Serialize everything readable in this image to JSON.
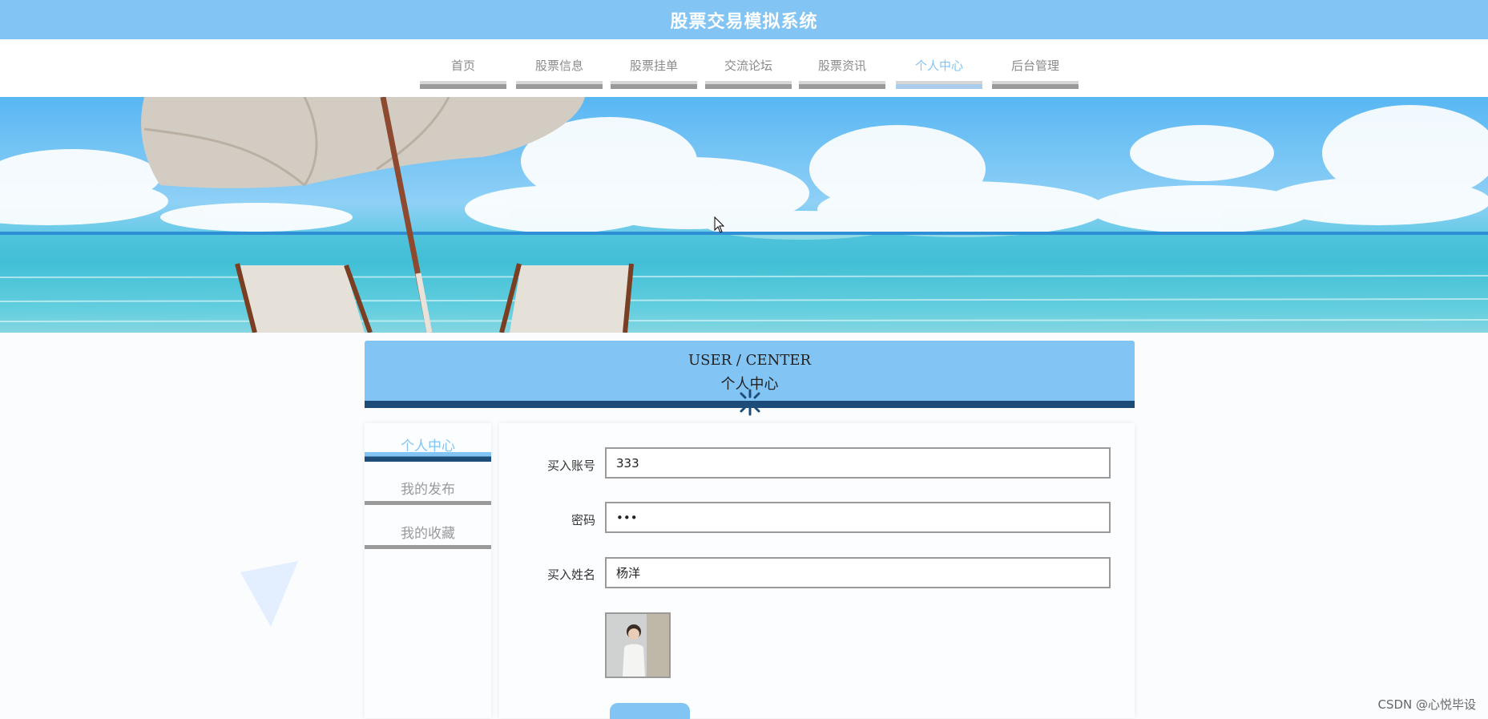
{
  "header": {
    "title": "股票交易模拟系统"
  },
  "nav": {
    "items": [
      {
        "label": "首页",
        "active": false
      },
      {
        "label": "股票信息",
        "active": false
      },
      {
        "label": "股票挂单",
        "active": false
      },
      {
        "label": "交流论坛",
        "active": false
      },
      {
        "label": "股票资讯",
        "active": false
      },
      {
        "label": "个人中心",
        "active": true
      },
      {
        "label": "后台管理",
        "active": false
      }
    ]
  },
  "section": {
    "title_en": "USER / CENTER",
    "title_cn": "个人中心"
  },
  "sidebar": {
    "items": [
      {
        "label": "个人中心",
        "active": true
      },
      {
        "label": "我的发布",
        "active": false
      },
      {
        "label": "我的收藏",
        "active": false
      }
    ]
  },
  "form": {
    "account": {
      "label": "买入账号",
      "value": "333"
    },
    "password": {
      "label": "密码",
      "value": "•••"
    },
    "name": {
      "label": "买入姓名",
      "value": "杨洋"
    }
  },
  "footer": {
    "watermark": "CSDN @心悦毕设"
  },
  "colors": {
    "accent": "#82c4f4",
    "dark_accent": "#1d4c78",
    "nav_text": "#8a8a8a"
  }
}
